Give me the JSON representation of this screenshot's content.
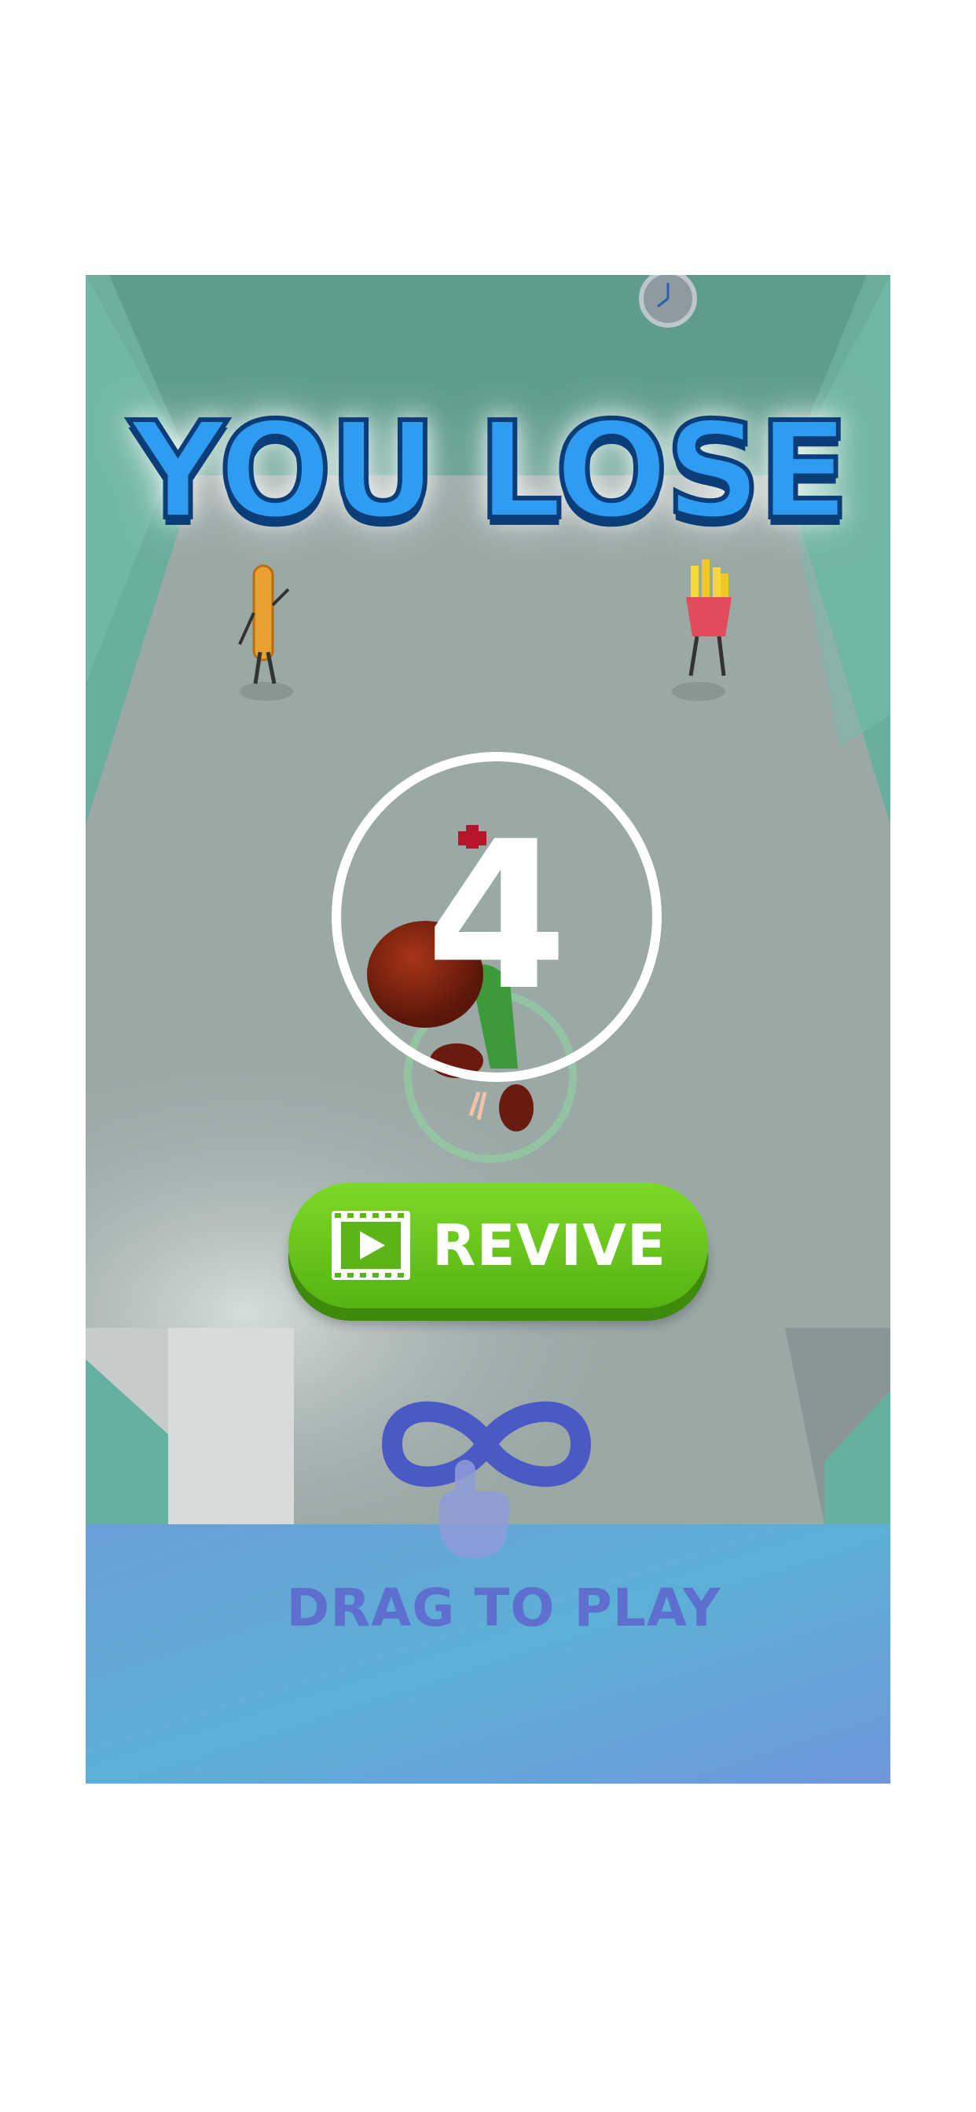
{
  "title": "YOU LOSE",
  "countdown": "4",
  "revive_button": {
    "label": "REVIVE",
    "icon": "video-play-icon"
  },
  "hint": {
    "label": "DRAG TO PLAY",
    "icon": "infinity-drag-gesture-icon"
  },
  "colors": {
    "title_fill": "#2e9cf0",
    "title_outline": "#0b3d78",
    "revive_green": "#6cc81e",
    "hint_blue": "#4a59c4",
    "floor": "#9aa8a6",
    "walls": "#63a898",
    "bottom_panel": "#6aa8dc"
  }
}
